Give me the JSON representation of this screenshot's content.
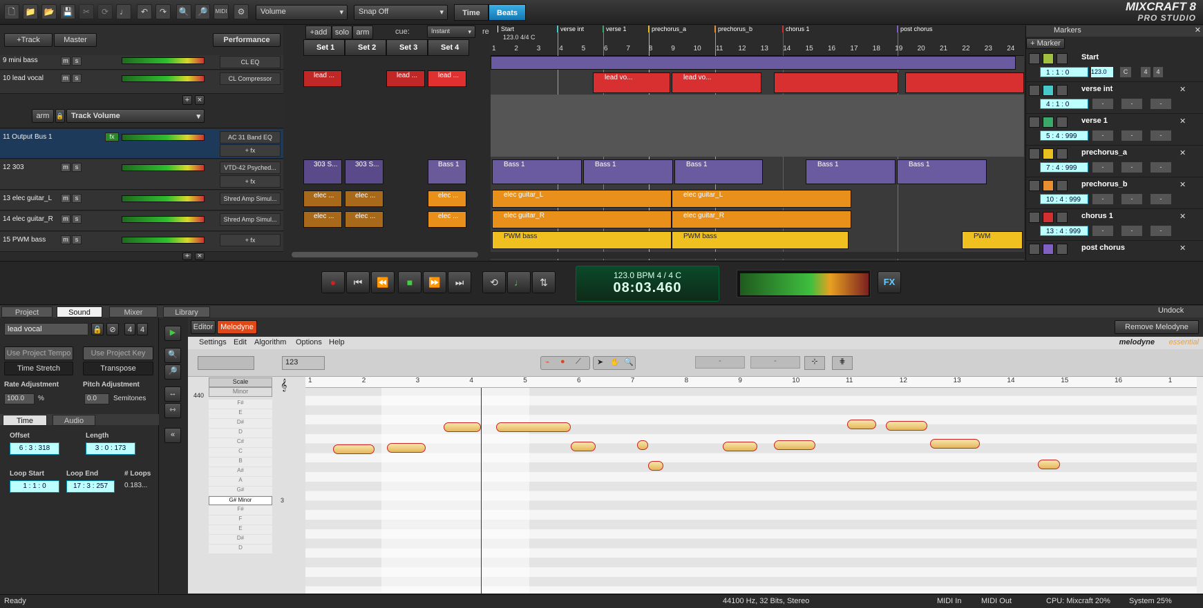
{
  "toolbar": {
    "volume_select": "Volume",
    "snap_select": "Snap Off",
    "time_label": "Time",
    "beats_label": "Beats",
    "logo_line1": "MIXCRAFT 8",
    "logo_line2": "PRO STUDIO",
    "icons": [
      "new-icon",
      "open-icon",
      "open-folder-icon",
      "save-icon",
      "cut-icon",
      "loop-icon",
      "metronome-icon",
      "undo-icon",
      "redo-icon",
      "zoom-in-icon",
      "zoom-out-icon",
      "midi-icon",
      "settings-icon"
    ]
  },
  "trackhdr": {
    "add_track": "+Track",
    "master": "Master",
    "performance": "Performance",
    "arm": "arm",
    "track_volume": "Track Volume",
    "add_fx": "+ fx"
  },
  "tracks": [
    {
      "name": "9 mini bass",
      "fx": "CL EQ"
    },
    {
      "name": "10 lead vocal",
      "fx": "CL Compressor"
    },
    {
      "name": "11 Output Bus 1",
      "fx": "AC 31 Band EQ",
      "fx_btn": "fx"
    },
    {
      "name": "12 303",
      "fx": "VTD-42 Psyched..."
    },
    {
      "name": "13 elec guitar_L",
      "fx": "Shred Amp Simul..."
    },
    {
      "name": "14 elec guitar_R",
      "fx": "Shred Amp Simul..."
    },
    {
      "name": "15 PWM bass",
      "fx": "+ fx"
    }
  ],
  "launcher": {
    "add": "+add",
    "solo": "solo",
    "arm": "arm",
    "cue": "cue:",
    "cue_mode": "Instant",
    "re": "re",
    "sets": [
      "Set 1",
      "Set 2",
      "Set 3",
      "Set 4"
    ],
    "clips": {
      "lead": "lead ...",
      "s303": "303 S...",
      "bass1": "Bass 1",
      "elec": "elec ..."
    }
  },
  "timeline": {
    "start_info": "123.0 4/4 C",
    "markers": [
      {
        "label": "Start",
        "color": "#ffffff"
      },
      {
        "label": "verse int",
        "color": "#48c8c8"
      },
      {
        "label": "verse 1",
        "color": "#3aa86a"
      },
      {
        "label": "prechorus_a",
        "color": "#e8c020"
      },
      {
        "label": "prechorus_b",
        "color": "#e89030"
      },
      {
        "label": "chorus 1",
        "color": "#d03030"
      },
      {
        "label": "post chorus",
        "color": "#8060c0"
      }
    ],
    "bars": [
      "1",
      "2",
      "3",
      "4",
      "5",
      "6",
      "7",
      "8",
      "9",
      "10",
      "11",
      "12",
      "13",
      "14",
      "15",
      "16",
      "17",
      "18",
      "19",
      "20",
      "21",
      "22",
      "23",
      "24"
    ],
    "clip_labels": {
      "lead": "lead vo...",
      "bass1": "Bass 1",
      "guitar_l": "elec guitar_L",
      "guitar_r": "elec guitar_R",
      "pwm": "PWM bass",
      "pwm_short": "PWM"
    }
  },
  "markers_panel": {
    "title": "Markers",
    "add": "+ Marker",
    "rows": [
      {
        "name": "Start",
        "time": "1 : 1 : 0",
        "tempo": "123.0",
        "key": "C",
        "sig1": "4",
        "sig2": "4",
        "color": "#a0c040"
      },
      {
        "name": "verse int",
        "time": "4 : 1 : 0",
        "color": "#48c8c8"
      },
      {
        "name": "verse 1",
        "time": "5 : 4 : 999",
        "color": "#3aa86a"
      },
      {
        "name": "prechorus_a",
        "time": "7 : 4 : 999",
        "color": "#e8c020"
      },
      {
        "name": "prechorus_b",
        "time": "10 : 4 : 999",
        "color": "#e89030"
      },
      {
        "name": "chorus 1",
        "time": "13 : 4 : 999",
        "color": "#d03030"
      },
      {
        "name": "post chorus",
        "color": "#8060c0"
      }
    ],
    "dash": "-"
  },
  "transport": {
    "bpm_line": "123.0 BPM   4 / 4    C",
    "time": "08:03.460",
    "fx": "FX"
  },
  "tabs": {
    "project": "Project",
    "sound": "Sound",
    "mixer": "Mixer",
    "library": "Library",
    "undock": "Undock"
  },
  "sound": {
    "clip_name": "lead vocal",
    "sig1": "4",
    "sig2": "4",
    "use_tempo": "Use Project Tempo",
    "time_stretch": "Time Stretch",
    "use_key": "Use Project Key",
    "transpose": "Transpose",
    "rate_label": "Rate Adjustment",
    "rate_value": "100.0",
    "rate_unit": "%",
    "pitch_label": "Pitch Adjustment",
    "pitch_value": "0.0",
    "pitch_unit": "Semitones",
    "subtab_time": "Time",
    "subtab_audio": "Audio",
    "offset_label": "Offset",
    "offset_value": "6 : 3 : 318",
    "length_label": "Length",
    "length_value": "3 : 0 : 173",
    "loop_start_label": "Loop Start",
    "loop_start_value": "1 : 1 : 0",
    "loop_end_label": "Loop End",
    "loop_end_value": "17 : 3 : 257",
    "loops_label": "# Loops",
    "loops_value": "0.183..."
  },
  "melodyne": {
    "editor_tab": "Editor",
    "melodyne_tab": "Melodyne",
    "remove": "Remove Melodyne",
    "menu": [
      "Settings",
      "Edit",
      "Algorithm",
      "Options",
      "Help"
    ],
    "brand": "melodyne",
    "brand2": "essential",
    "tempo_field": "123",
    "ref_pitch": "440",
    "scale_label": "Scale",
    "minor_label": "Minor",
    "key_label": "G# Minor",
    "key_num": "3",
    "pitch_names": [
      "F#",
      "E",
      "D#",
      "D",
      "C#",
      "C",
      "B",
      "A#",
      "A",
      "G#",
      "G",
      "F#",
      "F",
      "E",
      "D#",
      "D"
    ],
    "bars": [
      "1",
      "2",
      "3",
      "4",
      "5",
      "6",
      "7",
      "8",
      "9",
      "10",
      "11",
      "12",
      "13",
      "14",
      "15",
      "16",
      "1"
    ],
    "dash": "-"
  },
  "status": {
    "ready": "Ready",
    "format": "44100 Hz, 32 Bits, Stereo",
    "midi_in": "MIDI In",
    "midi_out": "MIDI Out",
    "cpu": "CPU: Mixcraft 20%",
    "system": "System 25%"
  }
}
